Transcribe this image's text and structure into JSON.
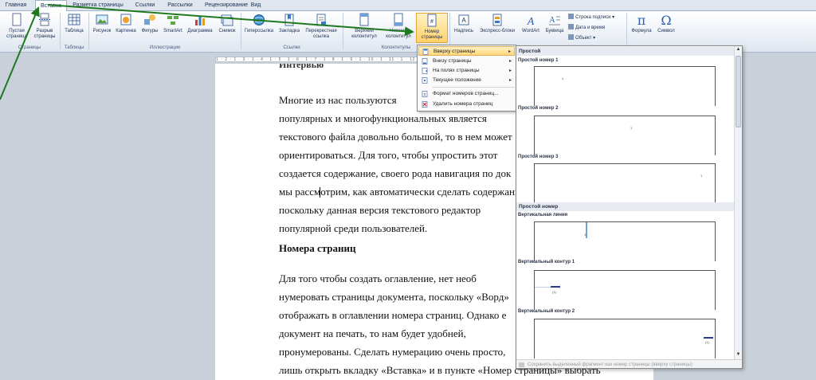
{
  "tabs": [
    {
      "label": "Главная",
      "active": false
    },
    {
      "label": "Вставка",
      "active": true
    },
    {
      "label": "Разметка страницы",
      "active": false
    },
    {
      "label": "Ссылки",
      "active": false
    },
    {
      "label": "Рассылки",
      "active": false
    },
    {
      "label": "Рецензирование",
      "active": false
    },
    {
      "label": "Вид",
      "active": false
    }
  ],
  "ribbon": {
    "blank_page": [
      "Пустая",
      "страница"
    ],
    "page_break": [
      "Разрыв",
      "страницы"
    ],
    "table": "Таблица",
    "picture": "Рисунок",
    "clipart": "Картинка",
    "shapes": "Фигуры",
    "smartart": "SmartArt",
    "chart": "Диаграмма",
    "screenshot": "Снимок",
    "hyperlink": "Гиперссылка",
    "bookmark": "Закладка",
    "crossref": [
      "Перекрестная",
      "ссылка"
    ],
    "header": [
      "Верхний",
      "колонтитул"
    ],
    "footer": [
      "Нижний",
      "колонтитул"
    ],
    "page_number": [
      "Номер",
      "страницы"
    ],
    "textbox": "Надпись",
    "quickparts": "Экспресс-блоки",
    "wordart": "WordArt",
    "dropcap": "Буквица",
    "signature_line": "Строка подписи",
    "date_time": "Дата и время",
    "object": "Объект",
    "formula": "Формула",
    "symbol": "Символ",
    "groups": {
      "pages": "Страницы",
      "tables": "Таблицы",
      "illustrations": "Иллюстрации",
      "links": "Ссылки",
      "headers": "Колонтитулы"
    }
  },
  "ruler": "1 · 2 · 1 · 3 · 1 · 4 · 1 · 5 · 1 · 6 · 1 · 7 · 1 · 8 · 1 · 9 · 1 · 10 · 1 · 11 · 1 · 12 · 1 · 13 · 1 · 14 · 1 · 15 · 1 · 16 · 1 · 17",
  "document": {
    "top_partial": "Интервью",
    "lines": [
      "Многие из нас пользуются",
      "популярных и многофункциональных является",
      "текстового файла довольно большой, то в нем может",
      "ориентироваться. Для того, чтобы упростить этот",
      "создается содержание, своего рода навигация по док",
      "мы рассмотрим, как автоматически сделать содержани",
      "поскольку данная версия текстового редактор",
      "популярной среди пользователей."
    ],
    "heading": "Номера страниц",
    "lines2": [
      "Для того чтобы создать оглавление, нет необ",
      "нумеровать страницы документа, поскольку «Ворд»",
      "отображать в оглавлении номера страниц. Однако е",
      "документ на печать, то нам будет удобней,",
      "пронумерованы. Сделать нумерацию очень просто,",
      "лишь открыть вкладку «Вставка» и в пункте «Номер страницы» выбрать"
    ]
  },
  "menu": {
    "items": [
      {
        "label": "Вверху страницы",
        "submenu": true,
        "selected": true
      },
      {
        "label": "Внизу страницы",
        "submenu": true,
        "selected": false
      },
      {
        "label": "На полях страницы",
        "submenu": true,
        "selected": false
      },
      {
        "label": "Текущее положение",
        "submenu": true,
        "selected": false
      },
      {
        "label": "Формат номеров страниц...",
        "submenu": false,
        "selected": false
      },
      {
        "label": "Удалить номера страниц",
        "submenu": false,
        "selected": false
      }
    ]
  },
  "gallery": {
    "section1": "Простой",
    "item1": "Простой номер 1",
    "item2": "Простой номер 2",
    "item3": "Простой номер 3",
    "section2": "Простой номер",
    "item4": "Вертикальная линия",
    "item5": "Вертикальный контур 1",
    "item6": "Вертикальный контур 2",
    "thumb_num": "1",
    "thumb_num_small": "(1)",
    "footer": "Сохранить выделенный фрагмент как номер страницы (вверху страницы)"
  },
  "colors": {
    "accent_highlight": "#ffd16a",
    "arrow": "#1f7a1f",
    "tab_text": "#1c2f52"
  }
}
